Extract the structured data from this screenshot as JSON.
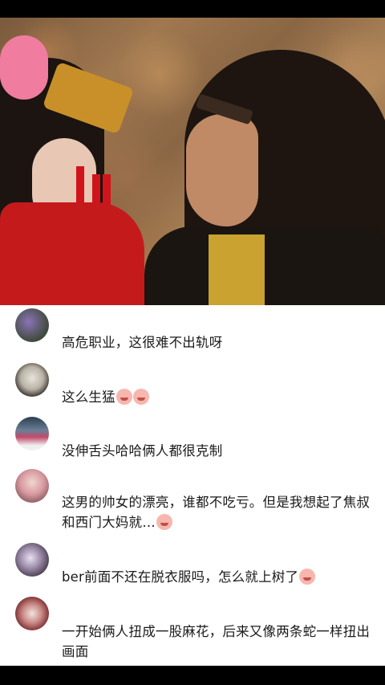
{
  "comments": [
    {
      "avatar": "avatar-purple-flowers",
      "text": "高危职业，这很难不出轨呀",
      "emojis": []
    },
    {
      "avatar": "avatar-cat",
      "text": "这么生猛",
      "emojis": [
        "crying-laugh-emoji",
        "crying-laugh-emoji"
      ]
    },
    {
      "avatar": "avatar-red-robe",
      "text": "没伸舌头哈哈俩人都很克制",
      "emojis": []
    },
    {
      "avatar": "avatar-girl-portrait",
      "text": "这男的帅女的漂亮，谁都不吃亏。但是我想起了焦叔和西门大妈就…",
      "emojis": [
        "sweat-emoji"
      ]
    },
    {
      "avatar": "avatar-flowers-dark",
      "text": "ber前面不还在脱衣服吗，怎么就上树了",
      "emojis": [
        "shy-emoji"
      ]
    },
    {
      "avatar": "avatar-nails",
      "text": "一开始俩人扭成一股麻花，后来又像两条蛇一样扭出画面",
      "emojis": []
    }
  ]
}
